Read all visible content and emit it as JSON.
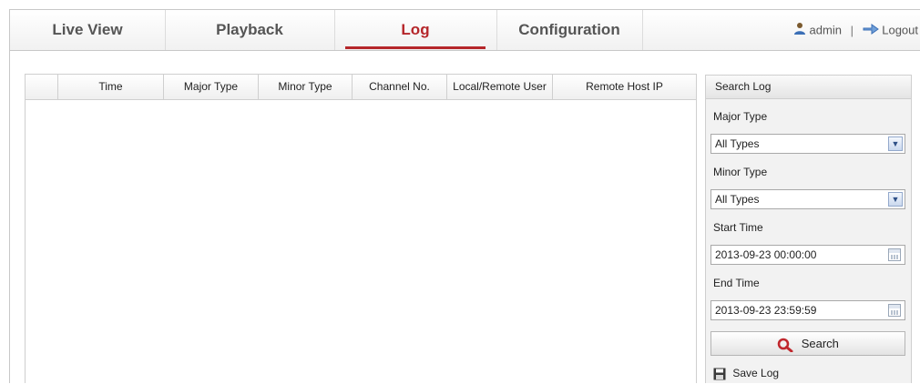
{
  "nav": {
    "tabs": [
      {
        "label": "Live View",
        "active": false
      },
      {
        "label": "Playback",
        "active": false
      },
      {
        "label": "Log",
        "active": true
      },
      {
        "label": "Configuration",
        "active": false
      }
    ],
    "user": "admin",
    "separator": "|",
    "logout": "Logout",
    "active_color": "#b5262a"
  },
  "table": {
    "columns": [
      "",
      "Time",
      "Major Type",
      "Minor Type",
      "Channel No.",
      "Local/Remote User",
      "Remote Host IP"
    ],
    "rows": []
  },
  "search": {
    "title": "Search Log",
    "major_type_label": "Major Type",
    "major_type_value": "All Types",
    "minor_type_label": "Minor Type",
    "minor_type_value": "All Types",
    "start_time_label": "Start Time",
    "start_time_value": "2013-09-23 00:00:00",
    "end_time_label": "End Time",
    "end_time_value": "2013-09-23 23:59:59",
    "search_button": "Search",
    "save_log": "Save Log"
  },
  "icons": {
    "user": "user-icon",
    "logout": "logout-icon",
    "dropdown": "chevron-down-icon",
    "calendar": "calendar-icon",
    "search": "search-icon",
    "save": "save-icon"
  }
}
